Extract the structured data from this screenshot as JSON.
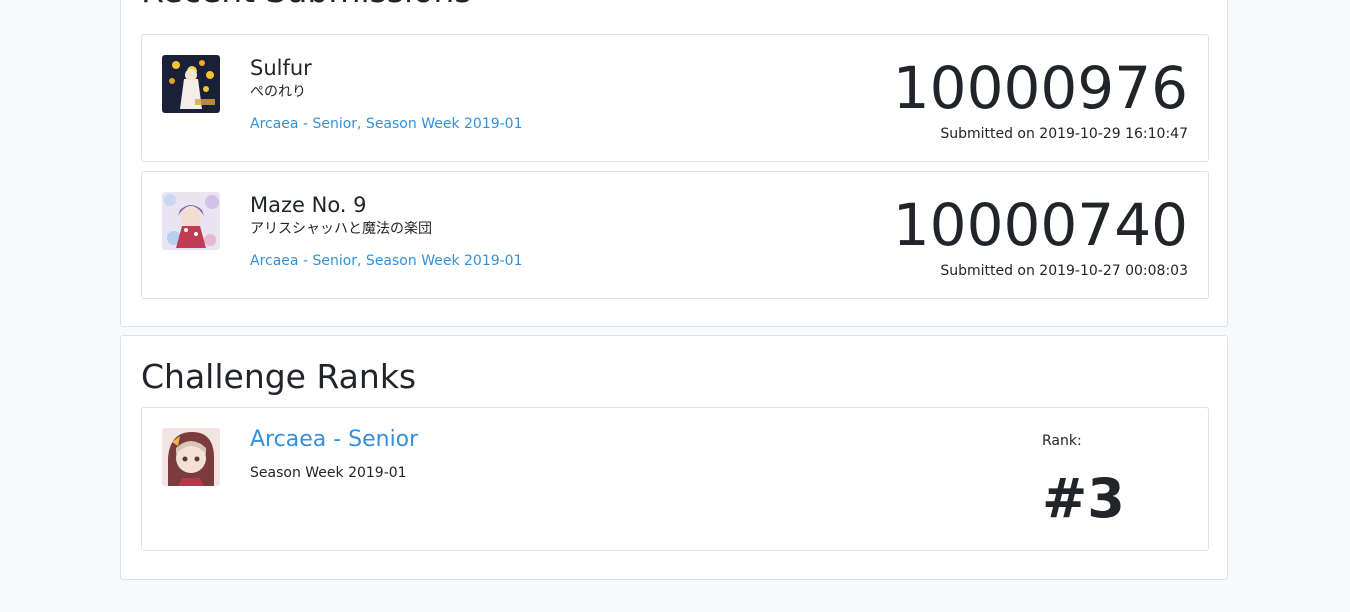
{
  "recent_submissions": {
    "title": "Recent Submissions",
    "items": [
      {
        "song_title": "Sulfur",
        "artist": "ぺのれり",
        "challenge": "Arcaea - Senior, Season Week 2019-01",
        "score": "10000976",
        "submitted": "Submitted on 2019-10-29 16:10:47",
        "thumbnail_icon": "album-art-image"
      },
      {
        "song_title": "Maze No. 9",
        "artist": "アリスシャッハと魔法の楽団",
        "challenge": "Arcaea - Senior, Season Week 2019-01",
        "score": "10000740",
        "submitted": "Submitted on 2019-10-27 00:08:03",
        "thumbnail_icon": "album-art-image"
      }
    ]
  },
  "challenge_ranks": {
    "title": "Challenge Ranks",
    "items": [
      {
        "name": "Arcaea - Senior",
        "season": "Season Week 2019-01",
        "rank_label": "Rank:",
        "rank": "#3",
        "thumbnail_icon": "game-character-image"
      }
    ]
  },
  "colors": {
    "link": "#3490dc",
    "text": "#212529",
    "border": "#dee2e6",
    "background": "#f8f9fa"
  }
}
